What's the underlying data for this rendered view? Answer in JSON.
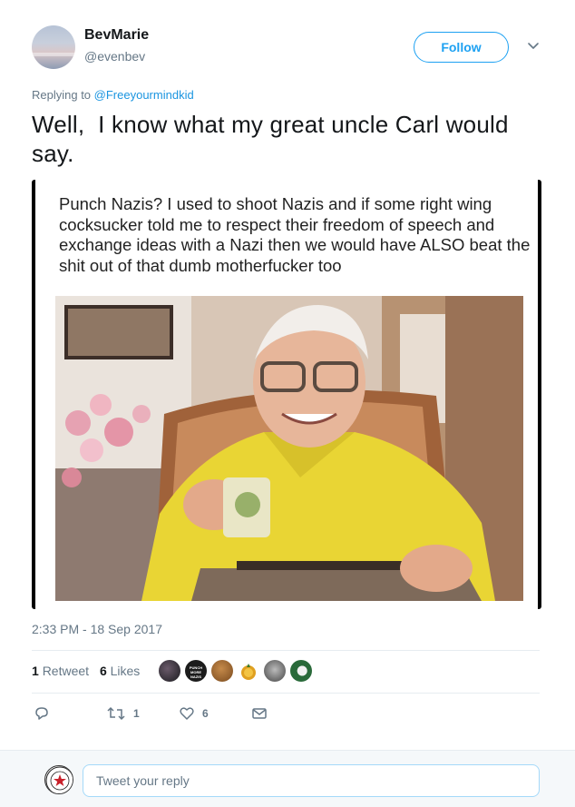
{
  "user": {
    "display_name": "BevMarie",
    "handle": "@evenbev",
    "follow_label": "Follow"
  },
  "reply_context": {
    "prefix": "Replying to",
    "target": "@Freeyourmindkid"
  },
  "tweet": {
    "text": "Well,  I know what my great uncle Carl would say.",
    "media": {
      "meme_text": "Punch Nazis? I used to shoot Nazis and if some right wing cocksucker told me to respect their freedom of speech and exchange ideas with a Nazi then we would have ALSO beat the shit out of that dumb motherfucker too"
    },
    "timestamp": "2:33 PM - 18 Sep 2017"
  },
  "stats": {
    "retweet_count": "1",
    "retweet_label": "Retweet",
    "like_count": "6",
    "like_label": "Likes",
    "liker_avatar_text": "PUNCH MORE NAZIS"
  },
  "actions": {
    "reply_icon": "reply-icon",
    "retweet_icon": "retweet-icon",
    "retweet_count": "1",
    "like_icon": "heart-icon",
    "like_count": "6",
    "dm_icon": "envelope-icon"
  },
  "reply_box": {
    "placeholder": "Tweet your reply",
    "avatar_text": "BECOME UNGOVERNABLE"
  },
  "colors": {
    "accent": "#1da1f2",
    "link": "#1b95e0",
    "muted": "#657786",
    "meme_shirt": "#e9d534"
  }
}
